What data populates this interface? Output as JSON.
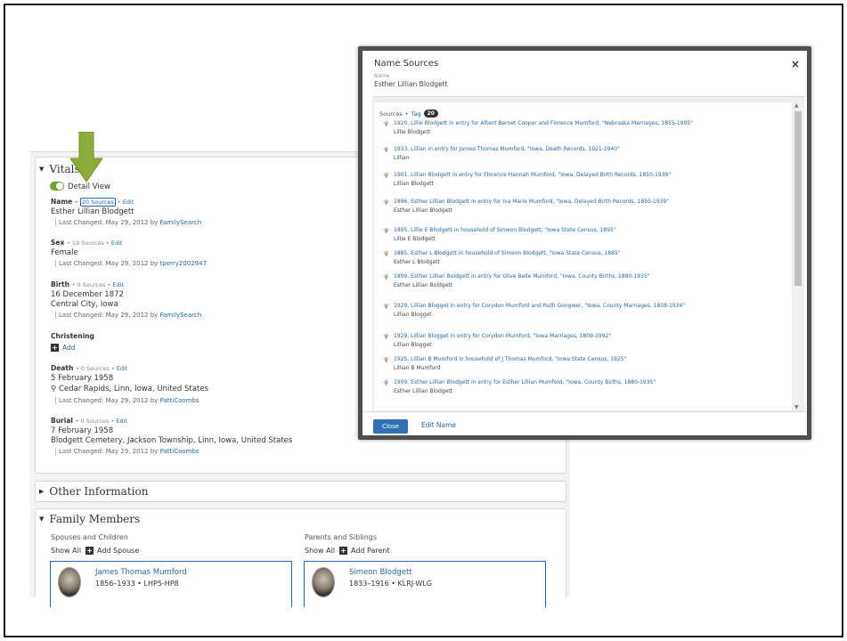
{
  "vitals": {
    "title": "Vitals",
    "detail_view": "Detail View",
    "name": {
      "label": "Name",
      "sources": "20 Sources",
      "edit": "Edit",
      "value": "Esther Lillian Blodgett",
      "changed": "Last Changed: May 29, 2012 by",
      "by": "FamilySearch"
    },
    "sex": {
      "label": "Sex",
      "sources": "19 Sources",
      "edit": "Edit",
      "value": "Female",
      "changed": "Last Changed: May 29, 2012 by",
      "by": "tperry2002947"
    },
    "birth": {
      "label": "Birth",
      "sources": "9 Sources",
      "edit": "Edit",
      "date": "16 December 1872",
      "place": "Central City, Iowa",
      "changed": "Last Changed: May 29, 2012 by",
      "by": "FamilySearch"
    },
    "christening": {
      "label": "Christening",
      "add": "Add"
    },
    "death": {
      "label": "Death",
      "sources": "0 Sources",
      "edit": "Edit",
      "date": "5 February 1958",
      "place": "Cedar Rapids, Linn, Iowa, United States",
      "changed": "Last Changed: May 29, 2012 by",
      "by": "PattiCoombs"
    },
    "burial": {
      "label": "Burial",
      "sources": "0 Sources",
      "edit": "Edit",
      "date": "7 February 1958",
      "place": "Blodgett Cemetery, Jackson Township, Linn, Iowa, United States",
      "changed": "Last Changed: May 29, 2012 by",
      "by": "PattiCoombs"
    }
  },
  "other_info": {
    "title": "Other Information"
  },
  "family": {
    "title": "Family Members",
    "spouses_heading": "Spouses and Children",
    "parents_heading": "Parents and Siblings",
    "show_all": "Show All",
    "add_spouse": "Add Spouse",
    "add_parent": "Add Parent",
    "spouse": {
      "name": "James Thomas Mumford",
      "dates": "1856–1933  •  LHP5-HP8"
    },
    "parent": {
      "name": "Simeon Blodgett",
      "dates": "1833–1916  •  KLRJ-WLG"
    }
  },
  "modal": {
    "title": "Name Sources",
    "close_icon": "×",
    "name_label": "Name",
    "name_value": "Esther Lillian Blodgett",
    "sources_label": "Sources",
    "tag_label": "Tag",
    "count": "20",
    "sources": [
      {
        "title": "1920, Lillie Blodgett in entry for Albert Barnet Cooper and Florence Mumford, \"Nebraska Marriages, 1855-1995\"",
        "name": "Lillie Blodgett"
      },
      {
        "title": "1933, Lillian in entry for James Thomas Mumford, \"Iowa, Death Records, 1921-1940\"",
        "name": "Lillian"
      },
      {
        "title": "1901, Lillian Blodgett in entry for Florence Hannah Mumford, \"Iowa, Delayed Birth Records, 1850-1939\"",
        "name": "Lillian Blodgett"
      },
      {
        "title": "1896, Esther Lillian Blodgett in entry for Iva Marie Mumford, \"Iowa, Delayed Birth Records, 1850-1939\"",
        "name": "Esther Lillian Blodgett"
      },
      {
        "title": "1895, Lillie E Blodgett in household of Simeon Blodgett, \"Iowa State Census, 1895\"",
        "name": "Lillie E Blodgett"
      },
      {
        "title": "1885, Esther L Blodgett in household of Simeon Blodgett, \"Iowa State Census, 1885\"",
        "name": "Esther L Blodgett"
      },
      {
        "title": "1899, Esther Lillian Boldgett in entry for Olive Belle Mumford, \"Iowa, County Births, 1880-1935\"",
        "name": "Esther Lillian Boldgett"
      },
      {
        "title": "1929, Lillian Blogget in entry for Corydon Mumford and Ruth Gongwer, \"Iowa, County Marriages, 1838-1934\"",
        "name": "Lillian Blogget"
      },
      {
        "title": "1929, Lillian Blogget in entry for Corydon Mumford, \"Iowa Marriages, 1809-1992\"",
        "name": "Lillian Blogget"
      },
      {
        "title": "1925, Lillian B Mumford in household of J Thomas Mumford, \"Iowa State Census, 1925\"",
        "name": "Lillian B Mumford"
      },
      {
        "title": "1909, Esther Lillian Blodgett in entry for Esther Lillian Mumford, \"Iowa, County Births, 1880-1935\"",
        "name": "Esther Lillian Blodgett"
      }
    ],
    "close_button": "Close",
    "edit_name": "Edit Name"
  }
}
